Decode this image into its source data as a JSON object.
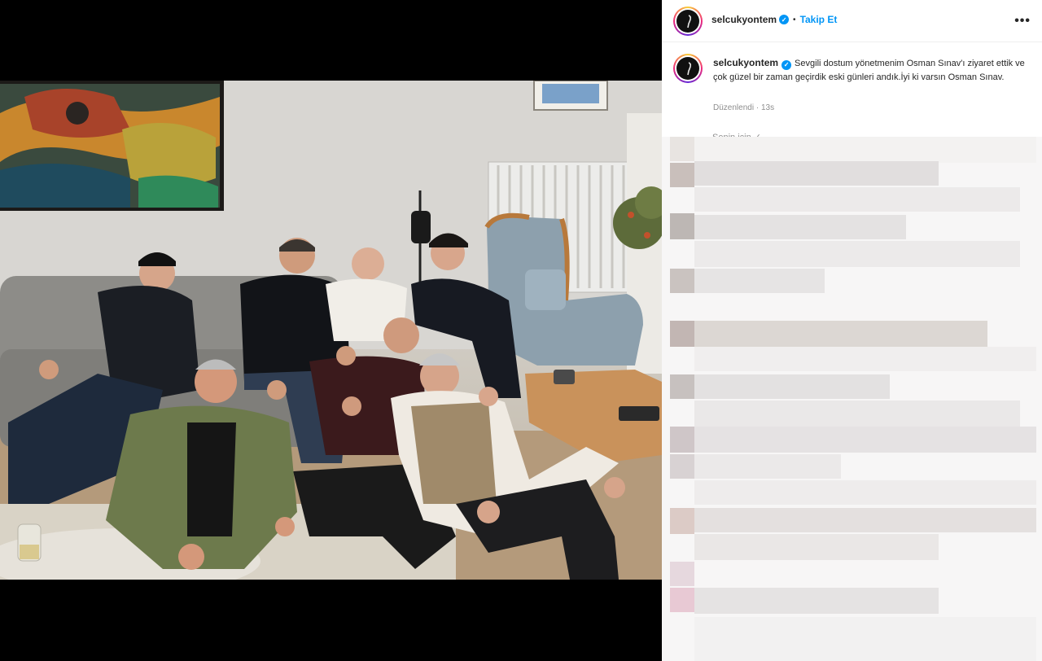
{
  "post": {
    "username": "selcukyontem",
    "follow_label": "Takip Et",
    "more_label": "•••",
    "separator": "•"
  },
  "caption": {
    "username": "selcukyontem",
    "text": "Sevgili dostum yönetmenim Osman Sınav'ı ziyaret ettik ve çok güzel bir zaman geçirdik eski günleri andık.İyi ki varsın Osman Sınav.",
    "edited_label": "Düzenlendi",
    "separator": "·",
    "time": "13s",
    "see_translation": "Senin için ✓"
  },
  "icons": {
    "verified": "verified-badge-icon",
    "more": "more-options-icon"
  },
  "colors": {
    "follow_blue": "#0095f6",
    "verified_blue": "#0095f6",
    "text": "#262626",
    "muted": "#8e8e8e"
  }
}
